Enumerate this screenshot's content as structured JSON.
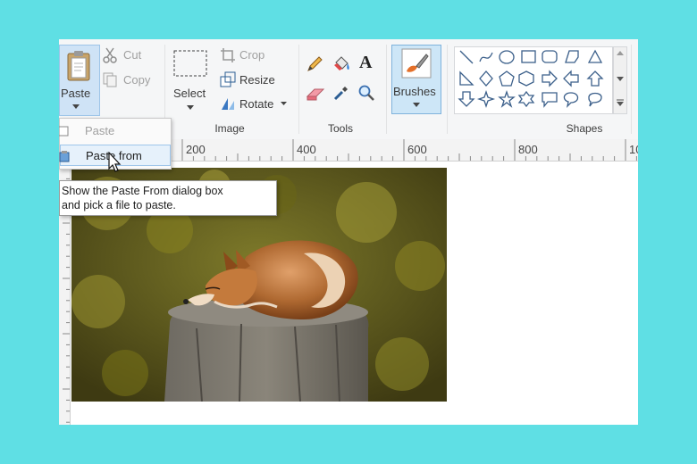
{
  "colors": {
    "background": "#5fdfe4",
    "ribbon": "#f5f6f7",
    "accent": "#cde6f7"
  },
  "clipboard": {
    "paste_label": "Paste",
    "cut_label": "Cut",
    "copy_label": "Copy"
  },
  "image_group": {
    "select_label": "Select",
    "crop_label": "Crop",
    "resize_label": "Resize",
    "rotate_label": "Rotate",
    "group_label": "Image"
  },
  "tools_group": {
    "group_label": "Tools"
  },
  "brushes_group": {
    "brushes_label": "Brushes"
  },
  "shapes_group": {
    "group_label": "Shapes"
  },
  "ruler": {
    "ticks": [
      "200",
      "400",
      "600",
      "800",
      "10"
    ]
  },
  "paste_menu": {
    "items": [
      {
        "label": "Paste"
      },
      {
        "label": "Paste from"
      }
    ]
  },
  "tooltip": {
    "line1": "Show the Paste From dialog box",
    "line2": "and pick a file to paste."
  }
}
